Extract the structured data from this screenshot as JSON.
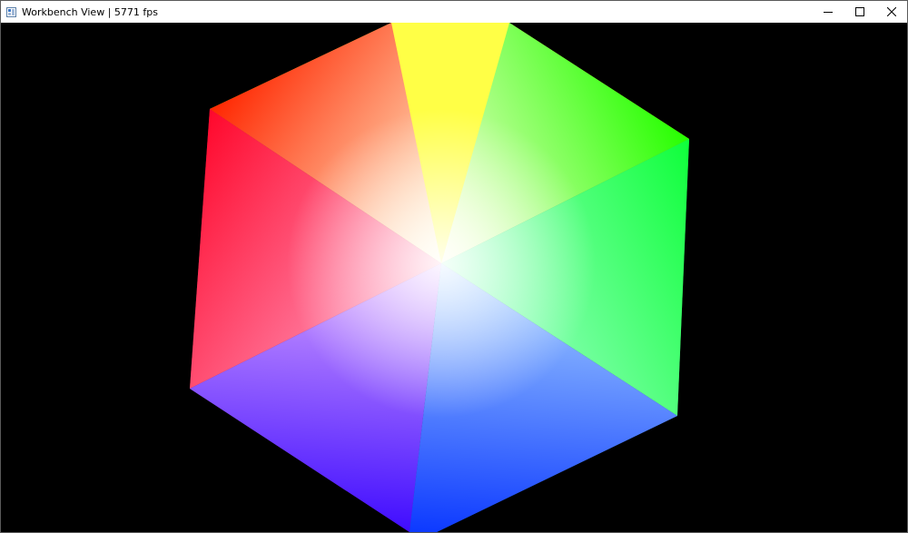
{
  "window": {
    "title": "Workbench View | 5771 fps",
    "controls": {
      "minimize_icon": "minimize-icon",
      "maximize_icon": "maximize-icon",
      "close_icon": "close-icon"
    }
  },
  "scene": {
    "background": "#000000",
    "object": "rgb-color-cube",
    "corner_colors": {
      "top": "#ffff00",
      "upper_left": "#ff0000",
      "upper_right": "#00ff00",
      "lower_left": "#ff00ff",
      "lower_right": "#00ffff",
      "bottom": "#0000ff",
      "center": "#ffffff"
    }
  }
}
